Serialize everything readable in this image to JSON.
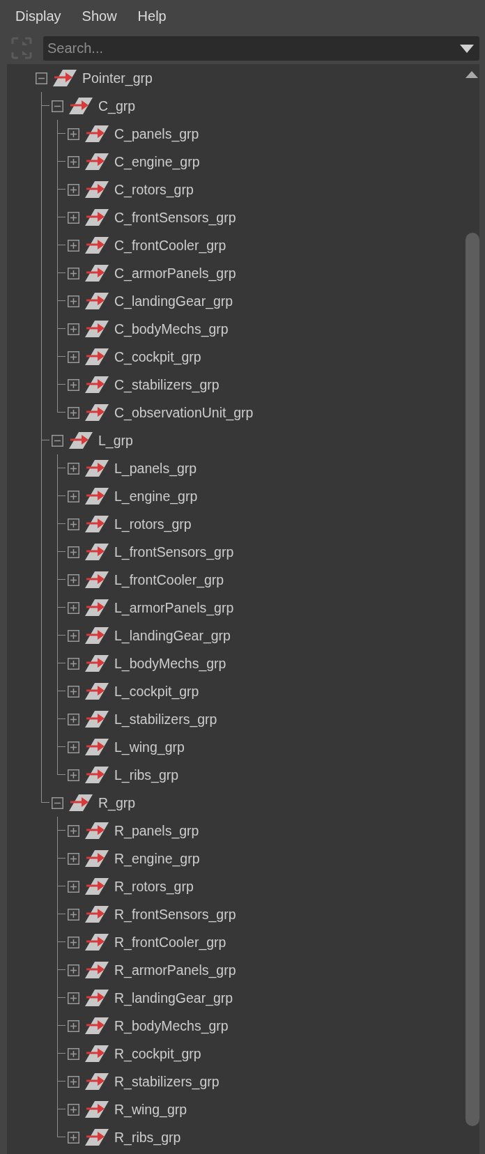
{
  "menu": [
    "Display",
    "Show",
    "Help"
  ],
  "search": {
    "placeholder": "Search..."
  },
  "tree": {
    "items": [
      {
        "label": "Pointer_grp",
        "expanded": true,
        "children": [
          {
            "label": "C_grp",
            "expanded": true,
            "children": [
              {
                "label": "C_panels_grp",
                "expanded": false
              },
              {
                "label": "C_engine_grp",
                "expanded": false
              },
              {
                "label": "C_rotors_grp",
                "expanded": false
              },
              {
                "label": "C_frontSensors_grp",
                "expanded": false
              },
              {
                "label": "C_frontCooler_grp",
                "expanded": false
              },
              {
                "label": "C_armorPanels_grp",
                "expanded": false
              },
              {
                "label": "C_landingGear_grp",
                "expanded": false
              },
              {
                "label": "C_bodyMechs_grp",
                "expanded": false
              },
              {
                "label": "C_cockpit_grp",
                "expanded": false
              },
              {
                "label": "C_stabilizers_grp",
                "expanded": false
              },
              {
                "label": "C_observationUnit_grp",
                "expanded": false
              }
            ]
          },
          {
            "label": "L_grp",
            "expanded": true,
            "children": [
              {
                "label": "L_panels_grp",
                "expanded": false
              },
              {
                "label": "L_engine_grp",
                "expanded": false
              },
              {
                "label": "L_rotors_grp",
                "expanded": false
              },
              {
                "label": "L_frontSensors_grp",
                "expanded": false
              },
              {
                "label": "L_frontCooler_grp",
                "expanded": false
              },
              {
                "label": "L_armorPanels_grp",
                "expanded": false
              },
              {
                "label": "L_landingGear_grp",
                "expanded": false
              },
              {
                "label": "L_bodyMechs_grp",
                "expanded": false
              },
              {
                "label": "L_cockpit_grp",
                "expanded": false
              },
              {
                "label": "L_stabilizers_grp",
                "expanded": false
              },
              {
                "label": "L_wing_grp",
                "expanded": false
              },
              {
                "label": "L_ribs_grp",
                "expanded": false
              }
            ]
          },
          {
            "label": "R_grp",
            "expanded": true,
            "children": [
              {
                "label": "R_panels_grp",
                "expanded": false
              },
              {
                "label": "R_engine_grp",
                "expanded": false
              },
              {
                "label": "R_rotors_grp",
                "expanded": false
              },
              {
                "label": "R_frontSensors_grp",
                "expanded": false
              },
              {
                "label": "R_frontCooler_grp",
                "expanded": false
              },
              {
                "label": "R_armorPanels_grp",
                "expanded": false
              },
              {
                "label": "R_landingGear_grp",
                "expanded": false
              },
              {
                "label": "R_bodyMechs_grp",
                "expanded": false
              },
              {
                "label": "R_cockpit_grp",
                "expanded": false
              },
              {
                "label": "R_stabilizers_grp",
                "expanded": false
              },
              {
                "label": "R_wing_grp",
                "expanded": false
              },
              {
                "label": "R_ribs_grp",
                "expanded": false
              }
            ]
          }
        ]
      }
    ]
  }
}
